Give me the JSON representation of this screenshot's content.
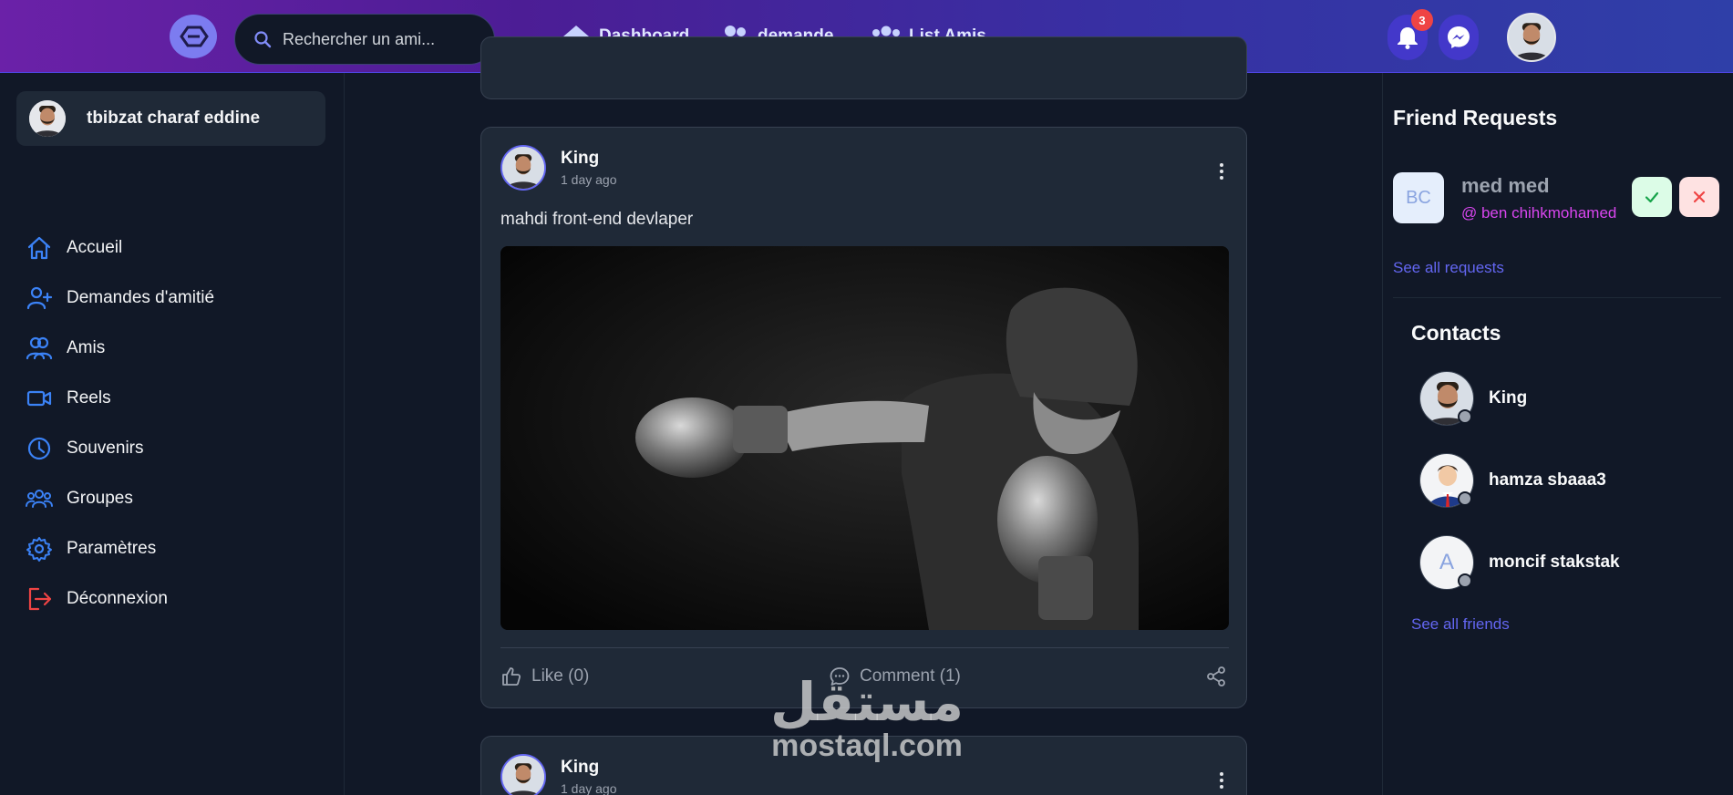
{
  "header": {
    "search_placeholder": "Rechercher un ami...",
    "nav": [
      {
        "label": "Dashboard",
        "icon": "home-icon"
      },
      {
        "label": "demande",
        "icon": "users-icon"
      },
      {
        "label": "List Amis",
        "icon": "user-group-icon"
      }
    ],
    "notification_count": "3"
  },
  "sidebar": {
    "user_name": "tbibzat charaf eddine",
    "items": [
      {
        "label": "Accueil",
        "icon": "home-icon"
      },
      {
        "label": "Demandes d'amitié",
        "icon": "user-plus-icon"
      },
      {
        "label": "Amis",
        "icon": "users-icon"
      },
      {
        "label": "Reels",
        "icon": "video-icon"
      },
      {
        "label": "Souvenirs",
        "icon": "clock-icon"
      },
      {
        "label": "Groupes",
        "icon": "group-icon"
      },
      {
        "label": "Paramètres",
        "icon": "gear-icon"
      },
      {
        "label": "Déconnexion",
        "icon": "logout-icon"
      }
    ]
  },
  "feed": {
    "posts": [
      {
        "author": "King",
        "time": "1 day ago",
        "text": "mahdi front-end devlaper",
        "like_label": "Like (0)",
        "comment_label": "Comment (1)"
      },
      {
        "author": "King",
        "time": "1 day ago"
      }
    ]
  },
  "friend_requests": {
    "title": "Friend Requests",
    "items": [
      {
        "initials": "BC",
        "name": "med med",
        "handle": "@ ben chihkmohamed"
      }
    ],
    "see_all": "See all requests"
  },
  "contacts": {
    "title": "Contacts",
    "items": [
      {
        "name": "King"
      },
      {
        "name": "hamza sbaaa3"
      },
      {
        "name": "moncif stakstak",
        "initial": "A"
      }
    ],
    "see_all": "See all friends"
  },
  "watermark": {
    "arabic": "مستقل",
    "latin": "mostaql.com"
  },
  "colors": {
    "accent": "#6366f1",
    "sidebar_icon": "#3b82f6",
    "logout_icon": "#ef4444",
    "badge": "#ef4444",
    "background": "#111827",
    "card": "#1f2937"
  }
}
